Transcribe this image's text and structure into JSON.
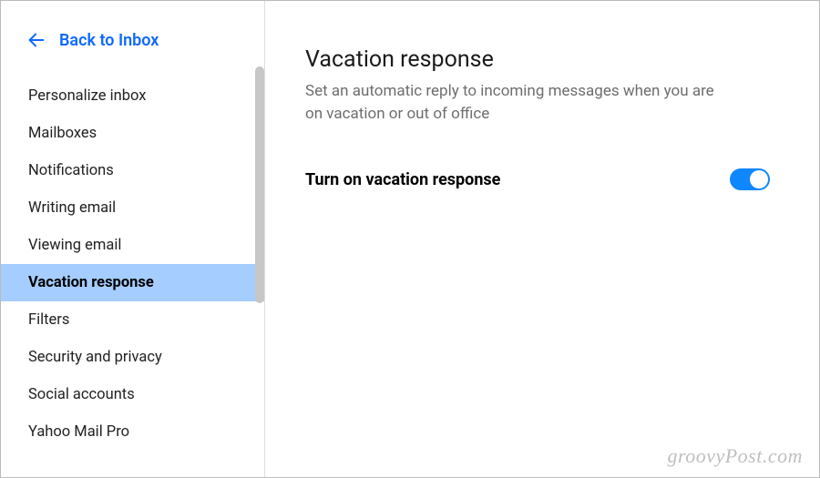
{
  "sidebar": {
    "back_label": "Back to Inbox",
    "items": [
      {
        "label": "Personalize inbox",
        "active": false
      },
      {
        "label": "Mailboxes",
        "active": false
      },
      {
        "label": "Notifications",
        "active": false
      },
      {
        "label": "Writing email",
        "active": false
      },
      {
        "label": "Viewing email",
        "active": false
      },
      {
        "label": "Vacation response",
        "active": true
      },
      {
        "label": "Filters",
        "active": false
      },
      {
        "label": "Security and privacy",
        "active": false
      },
      {
        "label": "Social accounts",
        "active": false
      },
      {
        "label": "Yahoo Mail Pro",
        "active": false
      }
    ]
  },
  "main": {
    "title": "Vacation response",
    "description": "Set an automatic reply to incoming messages when you are on vacation or out of office",
    "toggle_label": "Turn on vacation response",
    "toggle_on": true
  },
  "watermark": "groovyPost.com",
  "colors": {
    "accent": "#0f69ff",
    "toggle": "#0f87ff",
    "active_bg": "#a5cdff"
  }
}
